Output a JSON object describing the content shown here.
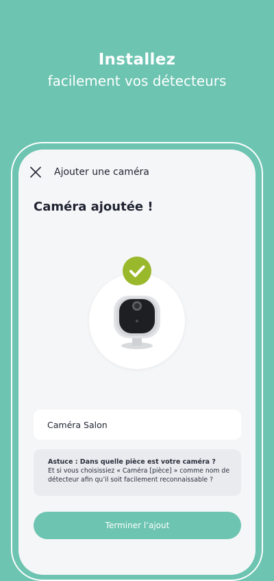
{
  "hero": {
    "title": "Installez",
    "subtitle": "facilement vos détecteurs"
  },
  "screen": {
    "appbar": {
      "title": "Ajouter une caméra",
      "close_icon": "close-icon"
    },
    "page_title": "Caméra ajoutée !",
    "illustration": {
      "icon": "camera-icon",
      "badge_icon": "check-icon",
      "badge_color": "#9ab82c"
    },
    "name_field": {
      "value": "Caméra Salon"
    },
    "tip": {
      "title": "Astuce : Dans quelle pièce est votre caméra ?",
      "body": "Et si vous choisissiez « Caméra [pièce] » comme nom de détecteur afin qu’il soit facilement reconnaissable ?"
    },
    "finish_button": {
      "label": "Terminer l’ajout"
    }
  },
  "colors": {
    "brand": "#6cc4b1",
    "success": "#9ab82c",
    "screen_bg": "#f5f6f8",
    "text": "#1f2330"
  }
}
